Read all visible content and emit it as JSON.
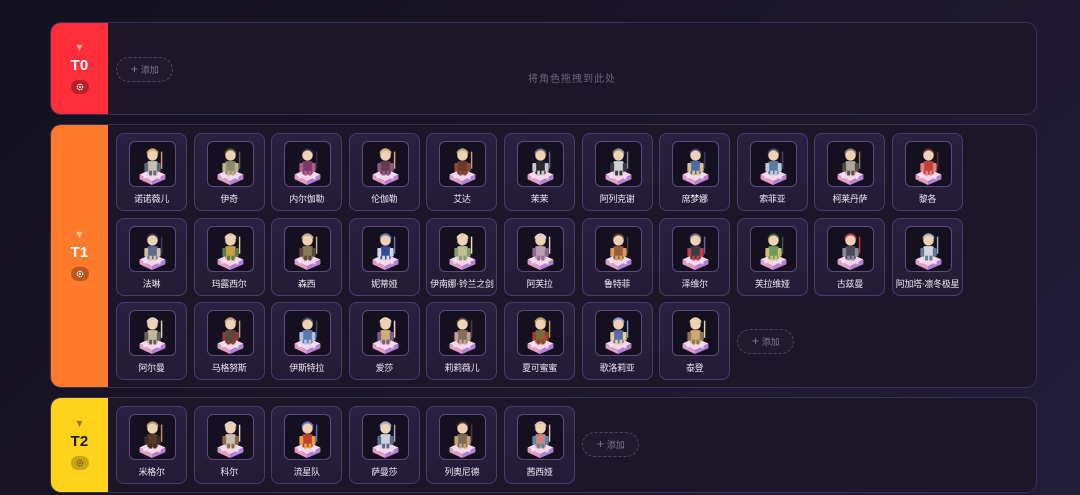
{
  "colors": {
    "t0": "#ff2e3a",
    "t1": "#ff7a2a",
    "t2": "#ffd21c",
    "card_border": "#4a3d6e",
    "row_bg": "#1d1629"
  },
  "icons": {
    "collapse": "caret-down-icon",
    "settings": "gear-icon",
    "add": "plus-icon"
  },
  "add_label": "添加",
  "tiers": [
    {
      "name": "T0",
      "empty_hint": "将角色拖拽到此处",
      "characters": []
    },
    {
      "name": "T1",
      "characters": [
        {
          "name": "诺诺薇儿",
          "palette": [
            "#c8c0b8",
            "#5a6878",
            "#c9a86a"
          ]
        },
        {
          "name": "伊奇",
          "palette": [
            "#8a8a70",
            "#bdb38a",
            "#5a5a48"
          ]
        },
        {
          "name": "内尔伽勒",
          "palette": [
            "#7a3a6a",
            "#b05a8a",
            "#3a2a40"
          ]
        },
        {
          "name": "伦伽勒",
          "palette": [
            "#6a3a4a",
            "#8a5a8a",
            "#e0b070"
          ]
        },
        {
          "name": "艾达",
          "palette": [
            "#6a3a2a",
            "#8a4a3a",
            "#c0a080"
          ]
        },
        {
          "name": "茉茉",
          "palette": [
            "#2a2a30",
            "#c8c8d0",
            "#6a6a80"
          ]
        },
        {
          "name": "阿列克谢",
          "palette": [
            "#d0d0d0",
            "#3a3a40",
            "#8a8a90"
          ]
        },
        {
          "name": "席梦娜",
          "palette": [
            "#4a6ab0",
            "#e0c080",
            "#3a3a60"
          ]
        },
        {
          "name": "索菲亚",
          "palette": [
            "#5a7aa0",
            "#c0c8d8",
            "#3a4a60"
          ]
        },
        {
          "name": "柯莱丹萨",
          "palette": [
            "#b0a8a0",
            "#5a4a40",
            "#8a7a70"
          ]
        },
        {
          "name": "黎各",
          "palette": [
            "#c04040",
            "#e08080",
            "#6a2a2a"
          ]
        },
        {
          "name": "法琳",
          "palette": [
            "#5a6a90",
            "#d0c0a0",
            "#3a3a5a"
          ]
        },
        {
          "name": "玛露西尔",
          "palette": [
            "#c8a040",
            "#5a7a50",
            "#e0d0a0"
          ]
        },
        {
          "name": "森西",
          "palette": [
            "#8a7a5a",
            "#5a4a3a",
            "#c0b090"
          ]
        },
        {
          "name": "妮蒂娅",
          "palette": [
            "#3a4a90",
            "#d0d8f0",
            "#6a7ab0"
          ]
        },
        {
          "name": "伊南娜·铃兰之剑",
          "palette": [
            "#c0c090",
            "#8a9a70",
            "#f0e0b0"
          ]
        },
        {
          "name": "阿芙拉",
          "palette": [
            "#c0a0b0",
            "#8a6a90",
            "#e0d0e0"
          ]
        },
        {
          "name": "鲁特菲",
          "palette": [
            "#9a5a3a",
            "#d0a060",
            "#5a3a2a"
          ]
        },
        {
          "name": "泽维尔",
          "palette": [
            "#3a3a4a",
            "#c04040",
            "#6a6a7a"
          ]
        },
        {
          "name": "芙拉维娅",
          "palette": [
            "#6a9a5a",
            "#d0c070",
            "#3a5a3a"
          ]
        },
        {
          "name": "古兹曼",
          "palette": [
            "#4a4a5a",
            "#8a8a9a",
            "#c03a3a"
          ]
        },
        {
          "name": "阿加塔·凛冬极星",
          "palette": [
            "#d0d8e0",
            "#6a7a90",
            "#a0b0c8"
          ]
        },
        {
          "name": "阿尔曼",
          "palette": [
            "#c0b8a0",
            "#6a6050",
            "#e0d8c0"
          ]
        },
        {
          "name": "马格努斯",
          "palette": [
            "#5a4a3a",
            "#8a3a3a",
            "#c0a080"
          ]
        },
        {
          "name": "伊斯特拉",
          "palette": [
            "#5a7ab0",
            "#b0c0d8",
            "#3a4a6a"
          ]
        },
        {
          "name": "爱莎",
          "palette": [
            "#d0b070",
            "#7a5a9a",
            "#f0e0c0"
          ]
        },
        {
          "name": "莉莉薇儿",
          "palette": [
            "#8a6a5a",
            "#c0a090",
            "#5a3a3a"
          ]
        },
        {
          "name": "夏可蜜蜜",
          "palette": [
            "#7a6a3a",
            "#a0402a",
            "#c0a060"
          ]
        },
        {
          "name": "歌洛莉亚",
          "palette": [
            "#5a6ab0",
            "#e0d090",
            "#8a9ad0"
          ]
        },
        {
          "name": "泰登",
          "palette": [
            "#d0a870",
            "#8a7a50",
            "#e8d8b0"
          ]
        }
      ]
    },
    {
      "name": "T2",
      "characters": [
        {
          "name": "米格尔",
          "palette": [
            "#5a3a2a",
            "#3a2a2a",
            "#c09070"
          ]
        },
        {
          "name": "科尔",
          "palette": [
            "#c8c0b0",
            "#8a6a4a",
            "#e0d8c8"
          ]
        },
        {
          "name": "流星队",
          "palette": [
            "#c04030",
            "#e0a040",
            "#5a70c0"
          ]
        },
        {
          "name": "萨曼莎",
          "palette": [
            "#d0d0d8",
            "#5a6a90",
            "#a0a8c0"
          ]
        },
        {
          "name": "列奥尼德",
          "palette": [
            "#7a6a5a",
            "#c0a070",
            "#4a3a30"
          ]
        },
        {
          "name": "茜西娅",
          "palette": [
            "#d08080",
            "#5a8aa0",
            "#e0c0c0"
          ]
        }
      ]
    }
  ]
}
